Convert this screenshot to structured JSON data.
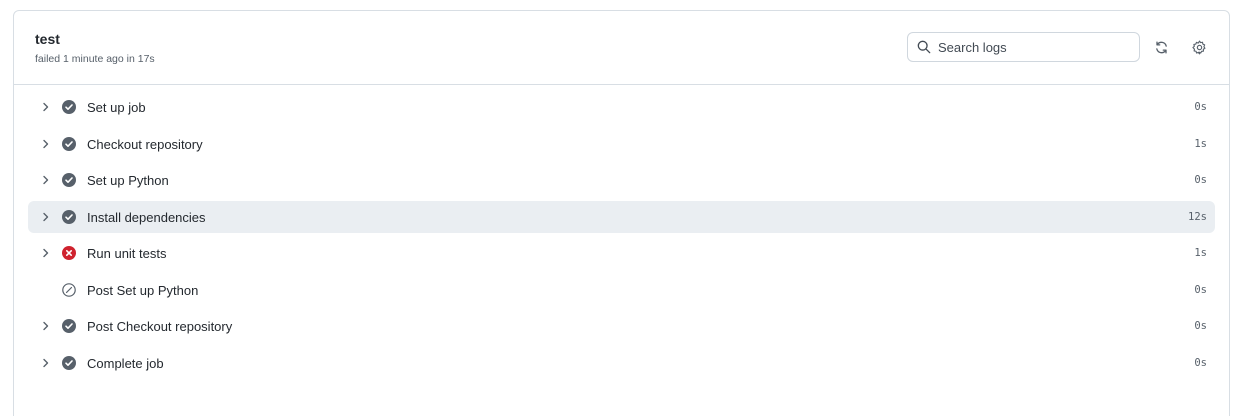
{
  "job": {
    "title": "test",
    "status_line": "failed 1 minute ago in 17s"
  },
  "toolbar": {
    "search_placeholder": "Search logs",
    "search_icon": "search-icon",
    "refresh_icon": "sync-icon",
    "settings_icon": "gear-icon"
  },
  "colors": {
    "success": "#57606a",
    "failure": "#cf222e",
    "skipped": "#57606a",
    "highlight_row": "#eaeef2"
  },
  "steps": [
    {
      "name": "Set up job",
      "duration": "0s",
      "status": "success",
      "expandable": true
    },
    {
      "name": "Checkout repository",
      "duration": "1s",
      "status": "success",
      "expandable": true
    },
    {
      "name": "Set up Python",
      "duration": "0s",
      "status": "success",
      "expandable": true
    },
    {
      "name": "Install dependencies",
      "duration": "12s",
      "status": "success",
      "expandable": true,
      "highlighted": true
    },
    {
      "name": "Run unit tests",
      "duration": "1s",
      "status": "failure",
      "expandable": true
    },
    {
      "name": "Post Set up Python",
      "duration": "0s",
      "status": "skipped",
      "expandable": false
    },
    {
      "name": "Post Checkout repository",
      "duration": "0s",
      "status": "success",
      "expandable": true
    },
    {
      "name": "Complete job",
      "duration": "0s",
      "status": "success",
      "expandable": true
    }
  ]
}
